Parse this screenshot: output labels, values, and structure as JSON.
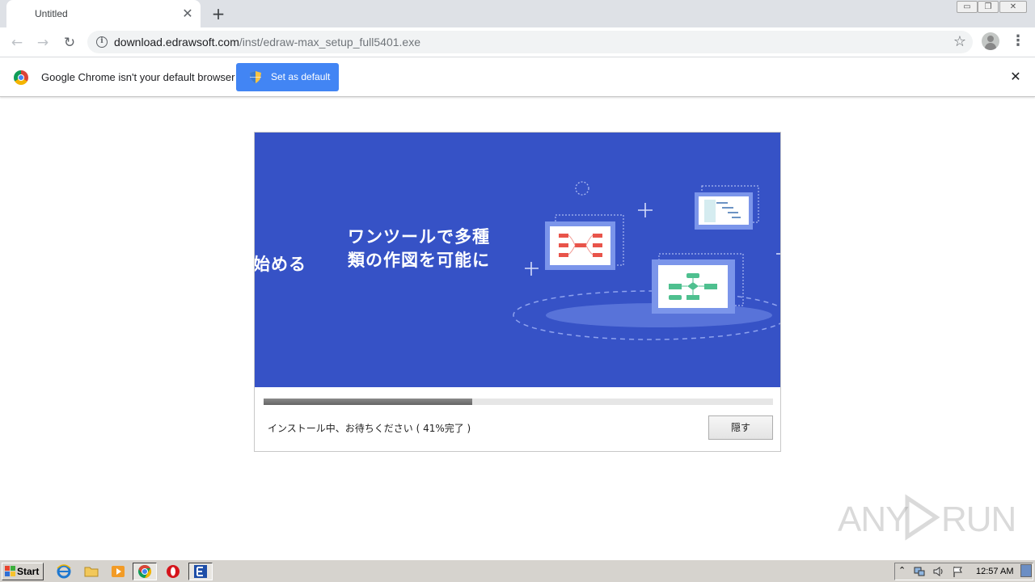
{
  "browser": {
    "tab_title": "Untitled",
    "tab_close": "✕",
    "new_tab": "+",
    "url_host": "download.edrawsoft.com",
    "url_path": "/inst/edraw-max_setup_full5401.exe",
    "window_buttons": [
      "▭",
      "❐",
      "✕"
    ]
  },
  "infobar": {
    "message": "Google Chrome isn't your default browser",
    "button_label": "Set as default",
    "close": "✕"
  },
  "installer": {
    "headline_line1": "ワンツールで多種",
    "headline_line2": "類の作図を可能に",
    "prev_slide_fragment": "始める",
    "progress": 0.41,
    "status": "インストール中、お待ちください ( 41%完了 )",
    "hide_button": "隠す",
    "colors": {
      "banner": "#3652c6",
      "accent_red": "#e8544a",
      "accent_green": "#4ec08f"
    }
  },
  "watermark": {
    "left": "ANY",
    "right": "RUN"
  },
  "taskbar": {
    "start_label": "Start",
    "clock": "12:57 AM",
    "icons": [
      "internet-explorer-icon",
      "folder-icon",
      "media-player-icon",
      "chrome-icon",
      "opera-icon",
      "edraw-icon"
    ]
  }
}
